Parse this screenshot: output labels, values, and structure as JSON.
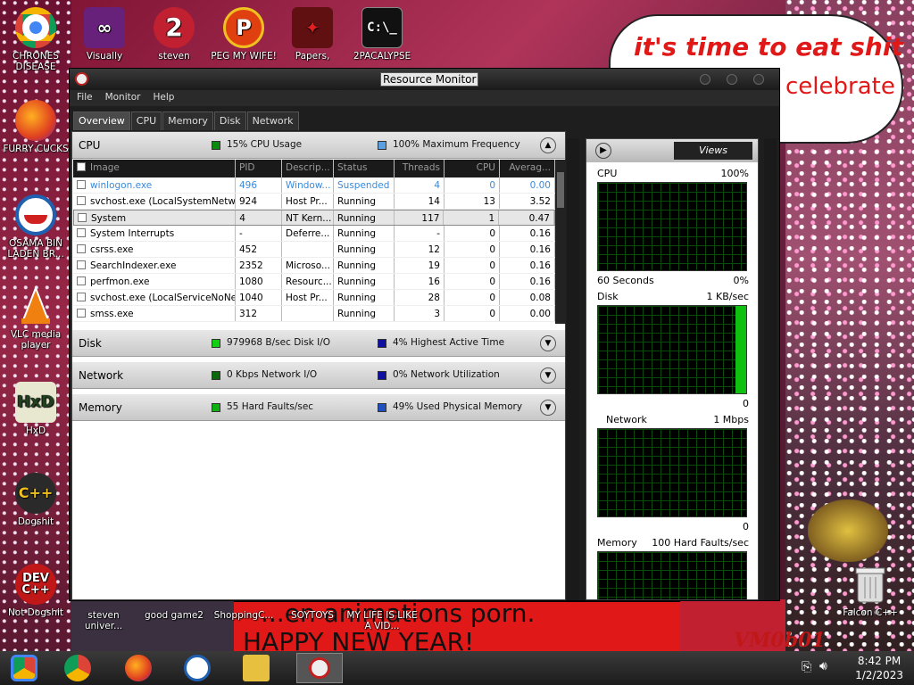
{
  "wallpaper": {
    "speech_line1": "it's time to eat shit",
    "speech_line2": "celebrate",
    "banner_line1": "...en animations porn.",
    "banner_line2": "HAPPY NEW YEAR!",
    "signature": "VM0b01"
  },
  "desktop_icons": [
    {
      "label": "CHRONES DISEASE",
      "icon": "chrome-icon"
    },
    {
      "label": "Visually",
      "icon": "visual-studio-icon"
    },
    {
      "label": "steven",
      "icon": "steven-icon"
    },
    {
      "label": "PEG MY WIFE!",
      "icon": "peg-icon"
    },
    {
      "label": "Papers,",
      "icon": "papers-icon"
    },
    {
      "label": "2PACALYPSE",
      "icon": "cmd-icon"
    },
    {
      "label": "FURRY CUCKS",
      "icon": "firefox-icon"
    },
    {
      "label": "OSAMA BIN LADEN BR...",
      "icon": "obama-icon"
    },
    {
      "label": "VLC media player",
      "icon": "vlc-icon"
    },
    {
      "label": "HxD",
      "icon": "hxd-icon"
    },
    {
      "label": "Dogshit",
      "icon": "cpp-icon"
    },
    {
      "label": "Not Dogshit",
      "icon": "devcpp-icon"
    },
    {
      "label": "steven univer...",
      "icon": "file-icon"
    },
    {
      "label": "good game2",
      "icon": "file-icon"
    },
    {
      "label": "ShoppingC...",
      "icon": "file-icon"
    },
    {
      "label": "SOYTOYS",
      "icon": "file-icon"
    },
    {
      "label": "MY LIFE IS LIKE A VID...",
      "icon": "file-icon"
    },
    {
      "label": "Falcon C++",
      "icon": "recycle-bin-icon"
    }
  ],
  "window": {
    "title": "Resource Monitor",
    "menu": [
      "File",
      "Monitor",
      "Help"
    ],
    "tabs": [
      "Overview",
      "CPU",
      "Memory",
      "Disk",
      "Network"
    ],
    "sections": {
      "cpu": {
        "name": "CPU",
        "stat1": "15% CPU Usage",
        "stat2": "100% Maximum Frequency"
      },
      "disk": {
        "name": "Disk",
        "stat1": "979968 B/sec Disk I/O",
        "stat2": "4% Highest Active Time"
      },
      "network": {
        "name": "Network",
        "stat1": "0 Kbps Network I/O",
        "stat2": "0% Network Utilization"
      },
      "memory": {
        "name": "Memory",
        "stat1": "55 Hard Faults/sec",
        "stat2": "49% Used Physical Memory"
      }
    },
    "table": {
      "headers": [
        "Image",
        "PID",
        "Descrip...",
        "Status",
        "Threads",
        "CPU",
        "Averag..."
      ],
      "rows": [
        [
          "winlogon.exe",
          "496",
          "Window...",
          "Suspended",
          "4",
          "0",
          "0.00"
        ],
        [
          "svchost.exe (LocalSystemNetw...",
          "924",
          "Host Pr...",
          "Running",
          "14",
          "13",
          "3.52"
        ],
        [
          "System",
          "4",
          "NT Kern...",
          "Running",
          "117",
          "1",
          "0.47"
        ],
        [
          "System Interrupts",
          "-",
          "Deferre...",
          "Running",
          "-",
          "0",
          "0.16"
        ],
        [
          "csrss.exe",
          "452",
          "",
          "Running",
          "12",
          "0",
          "0.16"
        ],
        [
          "SearchIndexer.exe",
          "2352",
          "Microso...",
          "Running",
          "19",
          "0",
          "0.16"
        ],
        [
          "perfmon.exe",
          "1080",
          "Resourc...",
          "Running",
          "16",
          "0",
          "0.16"
        ],
        [
          "svchost.exe (LocalServiceNoNe...",
          "1040",
          "Host Pr...",
          "Running",
          "28",
          "0",
          "0.08"
        ],
        [
          "smss.exe",
          "312",
          "",
          "Running",
          "3",
          "0",
          "0.00"
        ]
      ]
    },
    "right_panel": {
      "views_label": "Views",
      "cpu": {
        "label": "CPU",
        "max": "100%",
        "time": "60 Seconds",
        "min": "0%"
      },
      "disk": {
        "label": "Disk",
        "max": "1 KB/sec",
        "min": "0"
      },
      "network": {
        "label": "Network",
        "max": "1 Mbps",
        "min": "0"
      },
      "memory": {
        "label": "Memory",
        "max": "100 Hard Faults/sec"
      }
    }
  },
  "taskbar": {
    "time": "8:42 PM",
    "date": "1/2/2023"
  }
}
